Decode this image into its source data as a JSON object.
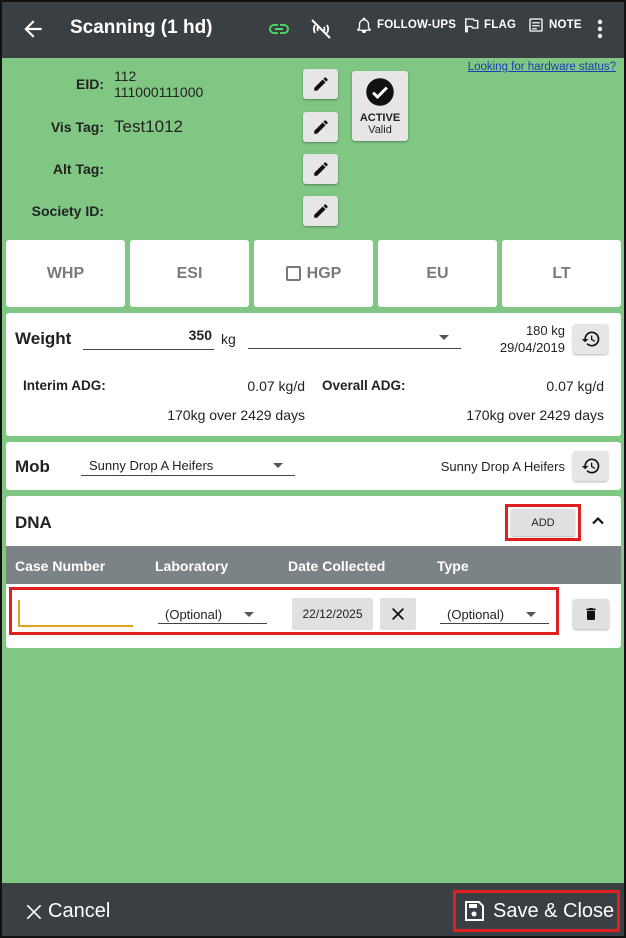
{
  "header": {
    "title": "Scanning (1 hd)",
    "follow_ups_label": "FOLLOW-UPS",
    "flag_label": "FLAG",
    "note_label": "NOTE"
  },
  "hardware_link": "Looking for hardware status?",
  "identifiers": [
    {
      "label": "EID:",
      "value": "112 111000111000"
    },
    {
      "label": "Vis Tag:",
      "value": "Test1012"
    },
    {
      "label": "Alt Tag:",
      "value": ""
    },
    {
      "label": "Society ID:",
      "value": ""
    }
  ],
  "status": {
    "state": "ACTIVE",
    "detail": "Valid"
  },
  "tiles": [
    "WHP",
    "ESI",
    "HGP",
    "EU",
    "LT"
  ],
  "weight": {
    "label": "Weight",
    "value": "350",
    "unit": "kg",
    "last_weight": "180 kg",
    "last_date": "29/04/2019",
    "interim_adg_label": "Interim ADG:",
    "interim_adg_value": "0.07 kg/d",
    "interim_detail": "170kg over 2429 days",
    "overall_adg_label": "Overall ADG:",
    "overall_adg_value": "0.07 kg/d",
    "overall_detail": "170kg over 2429 days"
  },
  "mob": {
    "label": "Mob",
    "selected": "Sunny Drop A Heifers",
    "current": "Sunny Drop A Heifers"
  },
  "dna": {
    "label": "DNA",
    "add_label": "ADD",
    "columns": [
      "Case Number",
      "Laboratory",
      "Date Collected",
      "Type"
    ],
    "row": {
      "case_number": "",
      "laboratory": "(Optional)",
      "date_collected": "22/12/2025",
      "type": "(Optional)"
    }
  },
  "footer": {
    "cancel_label": "Cancel",
    "save_label": "Save & Close"
  },
  "colors": {
    "background": "#81c784",
    "bar": "#3a3f44",
    "highlight": "#e02020",
    "link_icon": "#4cd964"
  }
}
